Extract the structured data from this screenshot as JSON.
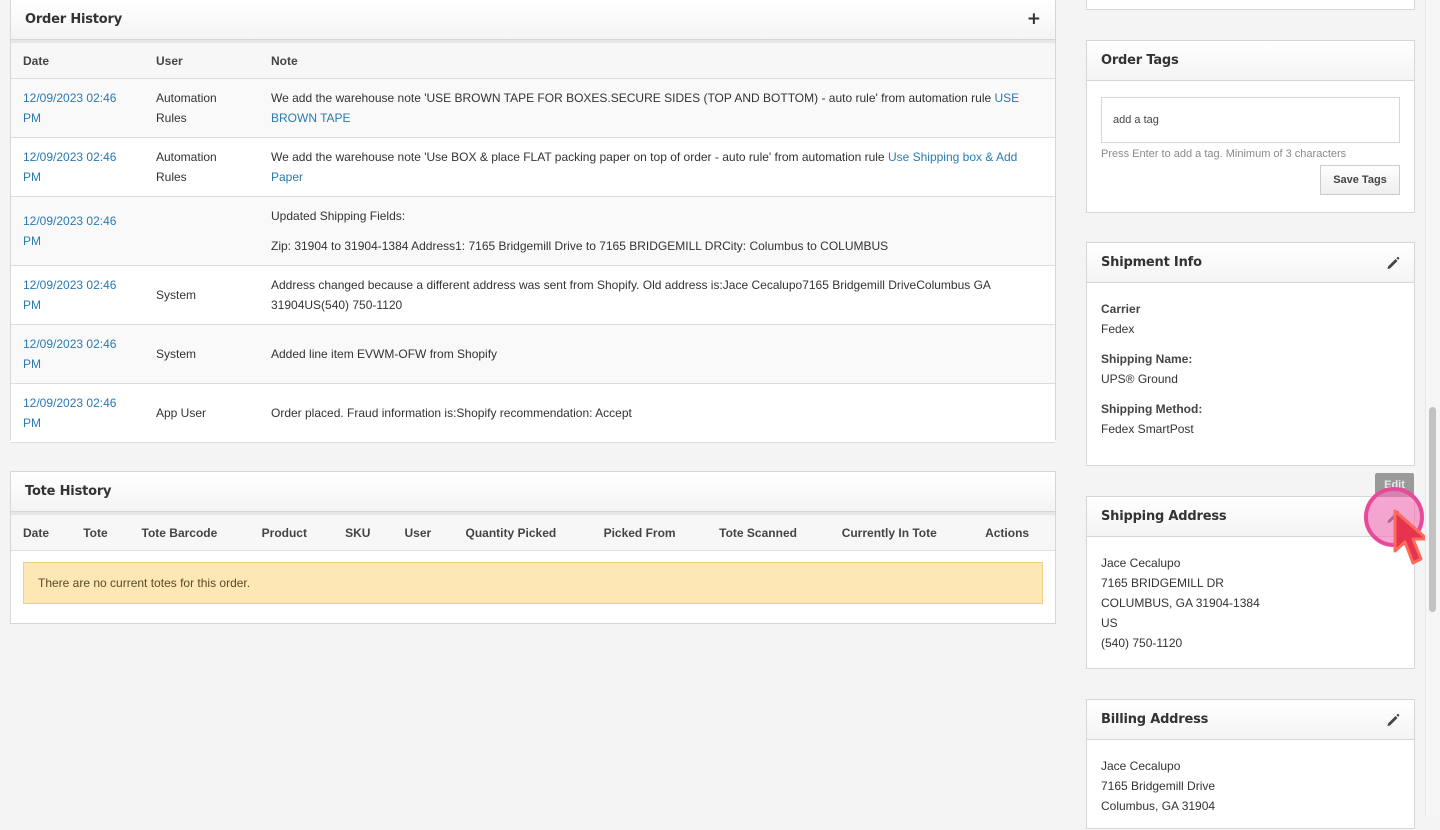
{
  "order_history": {
    "title": "Order History",
    "add_icon": "plus-icon",
    "columns": [
      "Date",
      "User",
      "Note"
    ],
    "rows": [
      {
        "date": "12/09/2023 02:46 PM",
        "user": "Automation Rules",
        "note": "We add the warehouse note 'USE BROWN TAPE FOR BOXES.SECURE SIDES (TOP AND BOTTOM) - auto rule' from automation rule ",
        "link": "USE BROWN TAPE",
        "note2": ""
      },
      {
        "date": "12/09/2023 02:46 PM",
        "user": "Automation Rules",
        "note": "We add the warehouse note 'Use BOX & place FLAT packing paper on top of order - auto rule' from automation rule ",
        "link": "Use Shipping box & Add Paper",
        "note2": ""
      },
      {
        "date": "12/09/2023 02:46 PM",
        "user": "",
        "note": "Updated Shipping Fields:",
        "link": "",
        "note2": "Zip: 31904 to 31904-1384 Address1: 7165 Bridgemill Drive to 7165 BRIDGEMILL DRCity: Columbus to COLUMBUS"
      },
      {
        "date": "12/09/2023 02:46 PM",
        "user": "System",
        "note": "Address changed because a different address was sent from Shopify. Old address is:Jace Cecalupo7165 Bridgemill DriveColumbus GA 31904US(540) 750-1120",
        "link": "",
        "note2": ""
      },
      {
        "date": "12/09/2023 02:46 PM",
        "user": "System",
        "note": "Added line item EVWM-OFW from Shopify",
        "link": "",
        "note2": ""
      },
      {
        "date": "12/09/2023 02:46 PM",
        "user": "App User",
        "note": "Order placed. Fraud information is:Shopify recommendation: Accept",
        "link": "",
        "note2": ""
      }
    ]
  },
  "tote_history": {
    "title": "Tote History",
    "columns": [
      "Date",
      "Tote",
      "Tote Barcode",
      "Product",
      "SKU",
      "User",
      "Quantity Picked",
      "Picked From",
      "Tote Scanned",
      "Currently In Tote",
      "Actions"
    ],
    "empty_message": "There are no current totes for this order."
  },
  "order_tags": {
    "title": "Order Tags",
    "input_placeholder": "add a tag",
    "hint": "Press Enter to add a tag. Minimum of 3 characters",
    "save_label": "Save Tags"
  },
  "shipment_info": {
    "title": "Shipment Info",
    "fields": [
      {
        "label": "Carrier",
        "value": "Fedex"
      },
      {
        "label": "Shipping Name:",
        "value": "UPS® Ground"
      },
      {
        "label": "Shipping Method:",
        "value": "Fedex SmartPost"
      }
    ]
  },
  "shipping_address": {
    "title": "Shipping Address",
    "tooltip": "Edit",
    "lines": [
      "Jace Cecalupo",
      "7165 BRIDGEMILL DR",
      "COLUMBUS, GA 31904-1384",
      "US",
      "(540) 750-1120"
    ]
  },
  "billing_address": {
    "title": "Billing Address",
    "lines": [
      "Jace Cecalupo",
      "7165 Bridgemill Drive",
      "Columbus, GA 31904"
    ]
  },
  "colors": {
    "link": "#2a7ab0",
    "alert_bg": "#fde7b5",
    "click_highlight": "#e84a9a"
  }
}
